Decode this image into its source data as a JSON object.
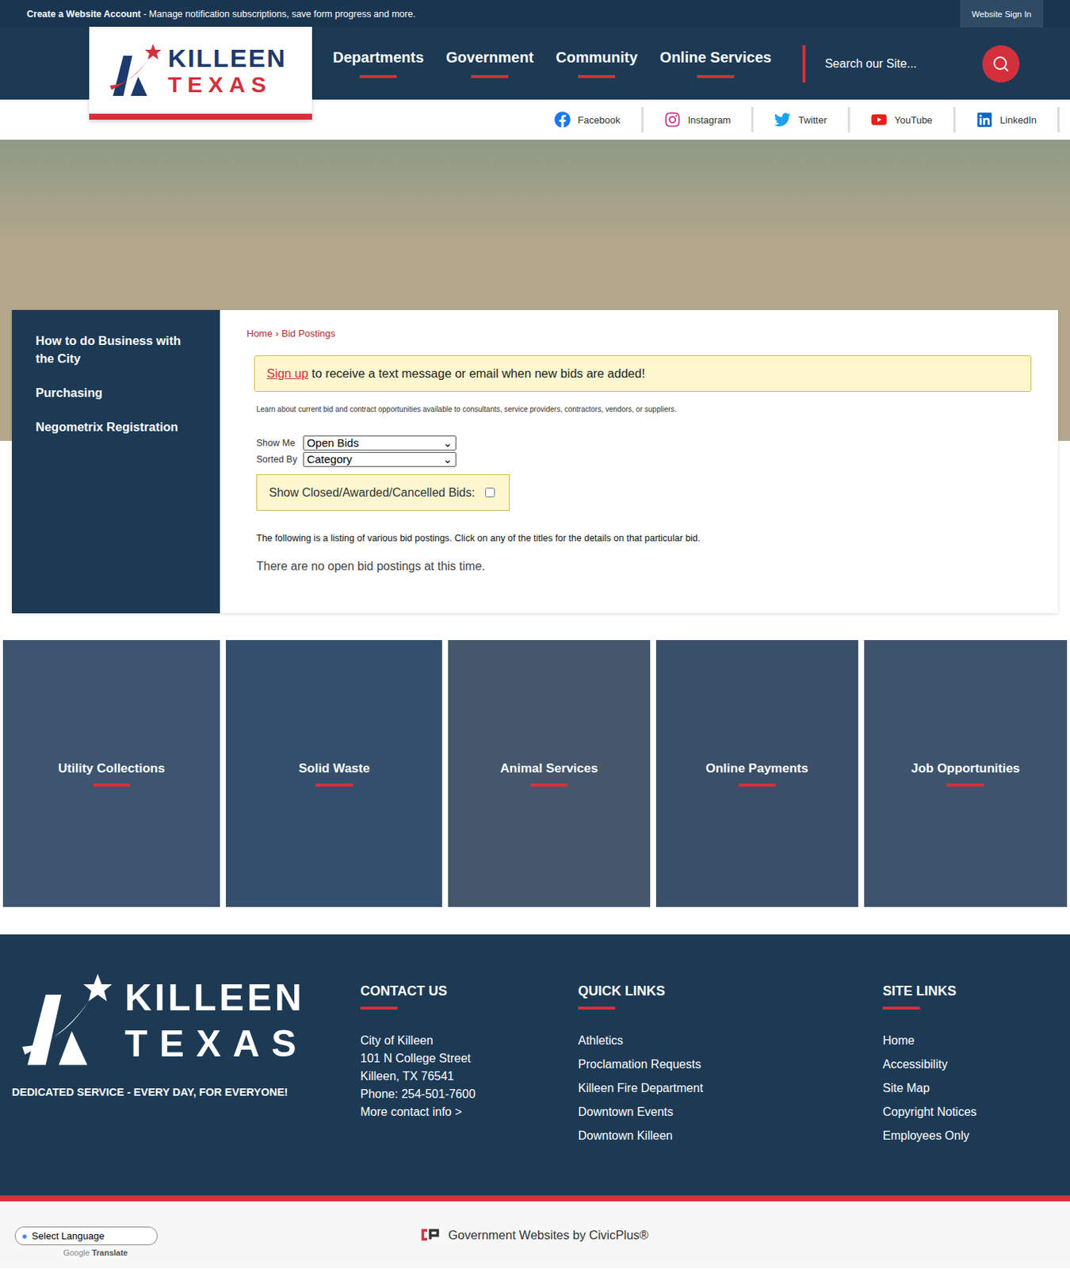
{
  "top_bar": {
    "account_link": "Create a Website Account",
    "account_text": " - Manage notification subscriptions, save form progress and more.",
    "sign_in": "Website Sign In"
  },
  "logo": {
    "line1": "KILLEEN",
    "line2": "TEXAS"
  },
  "nav": [
    {
      "label": "Departments"
    },
    {
      "label": "Government"
    },
    {
      "label": "Community"
    },
    {
      "label": "Online Services"
    }
  ],
  "search": {
    "placeholder": "Search our Site..."
  },
  "social": [
    {
      "label": "Facebook",
      "kind": "facebook"
    },
    {
      "label": "Instagram",
      "kind": "instagram"
    },
    {
      "label": "Twitter",
      "kind": "twitter"
    },
    {
      "label": "YouTube",
      "kind": "youtube"
    },
    {
      "label": "LinkedIn",
      "kind": "linkedin"
    }
  ],
  "sidebar": {
    "items": [
      "How to do Business with the City",
      "Purchasing",
      "Negometrix Registration"
    ]
  },
  "breadcrumb": [
    "Home",
    "›",
    "Bid Postings"
  ],
  "alert": {
    "link": "Sign up",
    "text": " to receive a text message or email when new bids are added!"
  },
  "description": "Learn about current bid and contract opportunities available to consultants, service providers, contractors, vendors, or suppliers.",
  "filters": [
    {
      "label": "Show Me",
      "value": "Open Bids"
    },
    {
      "label": "Sorted By",
      "value": "Category"
    }
  ],
  "closed_toggle": {
    "label": "Show Closed/Awarded/Cancelled Bids:",
    "checked": false
  },
  "listing_note": "The following is a listing of various bid postings. Click on any of the titles for the details on that particular bid.",
  "empty_message": "There are no open bid postings at this time.",
  "tiles": [
    "Utility Collections",
    "Solid Waste",
    "Animal Services",
    "Online Payments",
    "Job Opportunities"
  ],
  "footer": {
    "logo_line1": "KILLEEN",
    "logo_line2": "TEXAS",
    "tagline": "DEDICATED SERVICE - EVERY DAY, FOR EVERYONE!",
    "contact": {
      "title": "CONTACT US",
      "lines": [
        "City of Killeen",
        "101 N College Street",
        "Killeen, TX 76541",
        "Phone: 254-501-7600"
      ],
      "more": "More contact info >"
    },
    "quick_links": {
      "title": "QUICK LINKS",
      "items": [
        "Athletics",
        "Proclamation Requests",
        "Killeen Fire Department",
        "Downtown Events",
        "Downtown Killeen"
      ]
    },
    "site_links": {
      "title": "SITE LINKS",
      "items": [
        "Home",
        "Accessibility",
        "Site Map",
        "Copyright Notices",
        "Employees Only"
      ]
    }
  },
  "bottom": {
    "language": "Select Language",
    "powered": "Google",
    "translate": "Translate",
    "credit": "Government Websites by CivicPlus®"
  }
}
